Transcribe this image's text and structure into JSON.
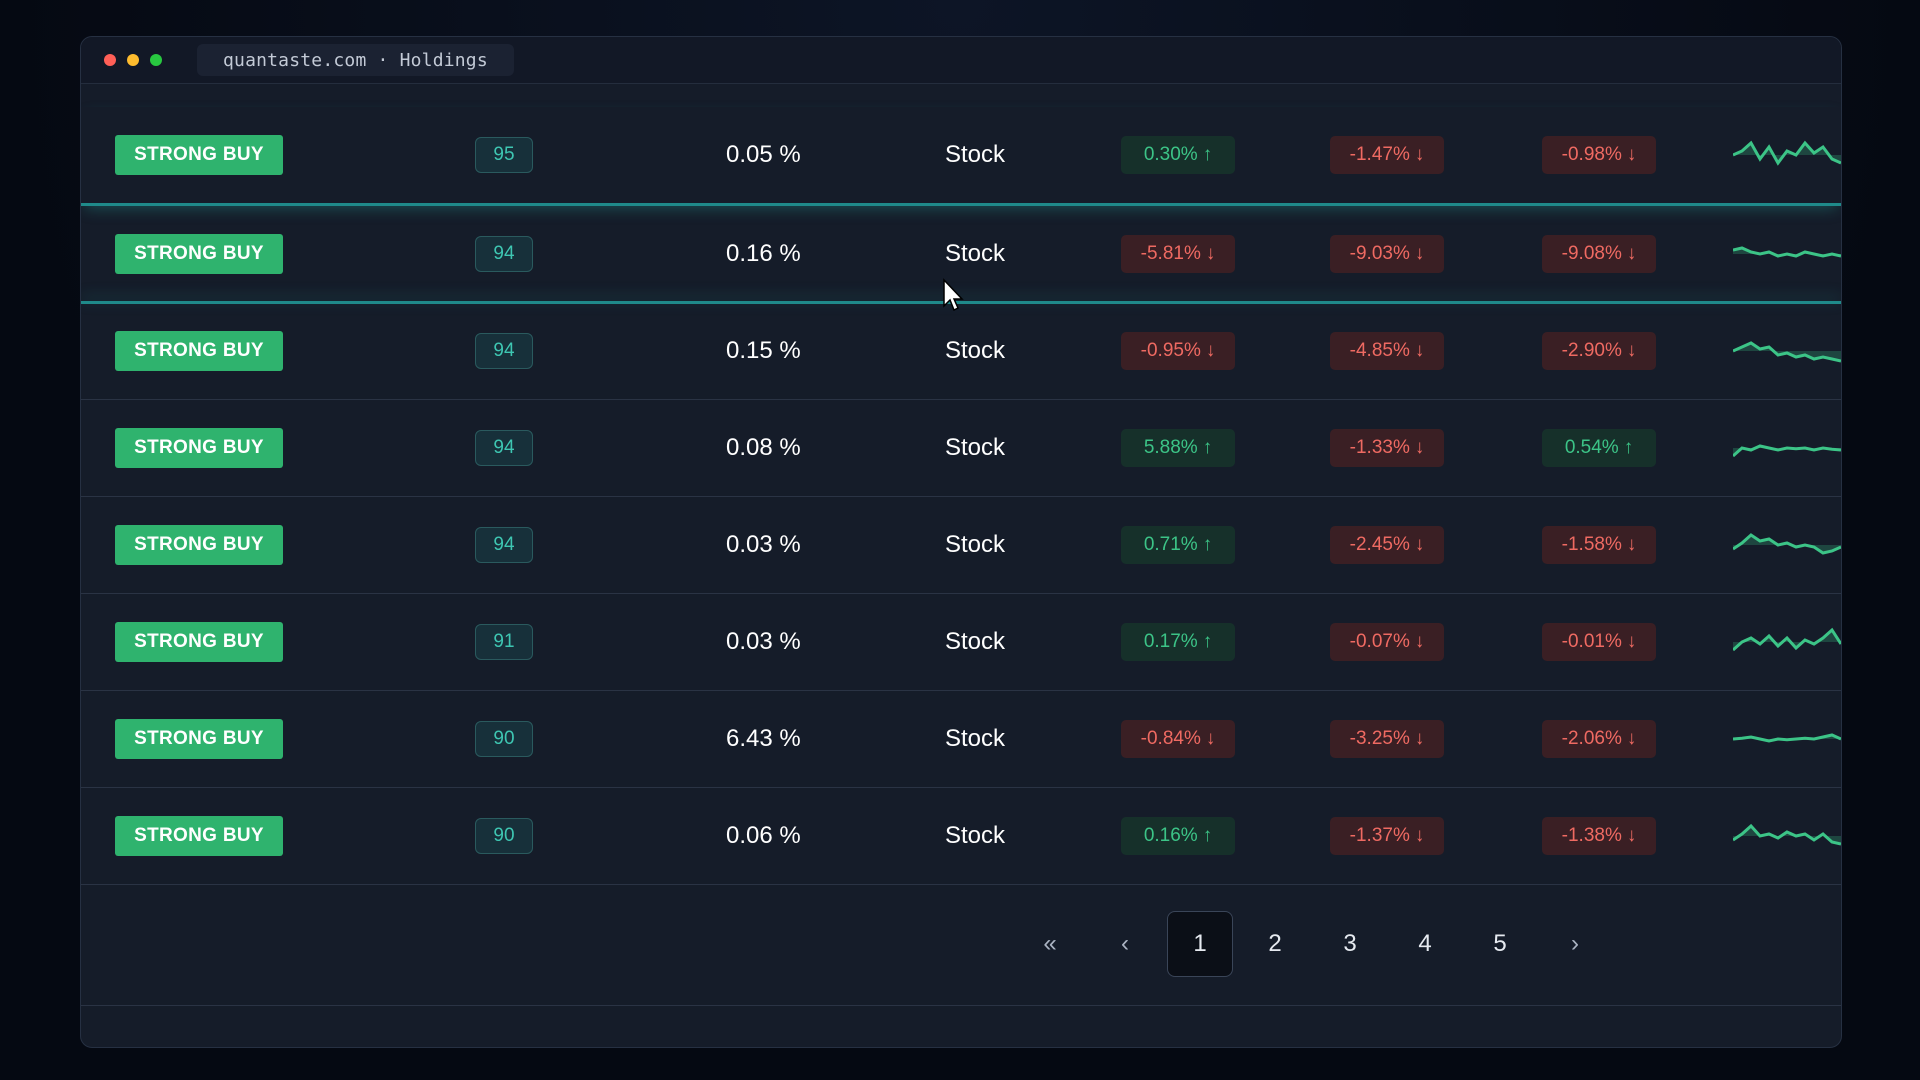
{
  "window": {
    "url_label": "quantaste.com · Holdings"
  },
  "rows": [
    {
      "rating": "STRONG BUY",
      "score": "95",
      "weight": "0.05 %",
      "type": "Stock",
      "c1": {
        "text": "0.30%",
        "dir": "up"
      },
      "c2": {
        "text": "-1.47%",
        "dir": "down"
      },
      "c3": {
        "text": "-0.98%",
        "dir": "down"
      },
      "spark": [
        0.5,
        0.6,
        0.8,
        0.4,
        0.7,
        0.3,
        0.6,
        0.5,
        0.8,
        0.55,
        0.7,
        0.4,
        0.3
      ],
      "spark_color": "#3cc487"
    },
    {
      "rating": "STRONG BUY",
      "score": "94",
      "weight": "0.16 %",
      "type": "Stock",
      "c1": {
        "text": "-5.81%",
        "dir": "down"
      },
      "c2": {
        "text": "-9.03%",
        "dir": "down"
      },
      "c3": {
        "text": "-9.08%",
        "dir": "down"
      },
      "spark": [
        0.6,
        0.65,
        0.55,
        0.5,
        0.55,
        0.45,
        0.5,
        0.45,
        0.55,
        0.5,
        0.45,
        0.5,
        0.45
      ],
      "spark_color": "#3cc487"
    },
    {
      "rating": "STRONG BUY",
      "score": "94",
      "weight": "0.15 %",
      "type": "Stock",
      "c1": {
        "text": "-0.95%",
        "dir": "down"
      },
      "c2": {
        "text": "-4.85%",
        "dir": "down"
      },
      "c3": {
        "text": "-2.90%",
        "dir": "down"
      },
      "spark": [
        0.5,
        0.6,
        0.7,
        0.55,
        0.6,
        0.4,
        0.45,
        0.35,
        0.4,
        0.3,
        0.35,
        0.3,
        0.25
      ],
      "spark_color": "#3cc487"
    },
    {
      "rating": "STRONG BUY",
      "score": "94",
      "weight": "0.08 %",
      "type": "Stock",
      "c1": {
        "text": "5.88%",
        "dir": "up"
      },
      "c2": {
        "text": "-1.33%",
        "dir": "down"
      },
      "c3": {
        "text": "0.54%",
        "dir": "up"
      },
      "spark": [
        0.3,
        0.5,
        0.45,
        0.55,
        0.5,
        0.45,
        0.5,
        0.48,
        0.5,
        0.45,
        0.5,
        0.47,
        0.45
      ],
      "spark_color": "#3cc487"
    },
    {
      "rating": "STRONG BUY",
      "score": "94",
      "weight": "0.03 %",
      "type": "Stock",
      "c1": {
        "text": "0.71%",
        "dir": "up"
      },
      "c2": {
        "text": "-2.45%",
        "dir": "down"
      },
      "c3": {
        "text": "-1.58%",
        "dir": "down"
      },
      "spark": [
        0.4,
        0.55,
        0.75,
        0.6,
        0.65,
        0.5,
        0.55,
        0.45,
        0.5,
        0.45,
        0.3,
        0.35,
        0.45
      ],
      "spark_color": "#3cc487"
    },
    {
      "rating": "STRONG BUY",
      "score": "91",
      "weight": "0.03 %",
      "type": "Stock",
      "c1": {
        "text": "0.17%",
        "dir": "up"
      },
      "c2": {
        "text": "-0.07%",
        "dir": "down"
      },
      "c3": {
        "text": "-0.01%",
        "dir": "down"
      },
      "spark": [
        0.3,
        0.5,
        0.6,
        0.45,
        0.65,
        0.4,
        0.6,
        0.35,
        0.55,
        0.45,
        0.6,
        0.8,
        0.45
      ],
      "spark_color": "#3cc487"
    },
    {
      "rating": "STRONG BUY",
      "score": "90",
      "weight": "6.43 %",
      "type": "Stock",
      "c1": {
        "text": "-0.84%",
        "dir": "down"
      },
      "c2": {
        "text": "-3.25%",
        "dir": "down"
      },
      "c3": {
        "text": "-2.06%",
        "dir": "down"
      },
      "spark": [
        0.5,
        0.52,
        0.55,
        0.5,
        0.45,
        0.5,
        0.48,
        0.5,
        0.52,
        0.5,
        0.55,
        0.6,
        0.5
      ],
      "spark_color": "#3cc487"
    },
    {
      "rating": "STRONG BUY",
      "score": "90",
      "weight": "0.06 %",
      "type": "Stock",
      "c1": {
        "text": "0.16%",
        "dir": "up"
      },
      "c2": {
        "text": "-1.37%",
        "dir": "down"
      },
      "c3": {
        "text": "-1.38%",
        "dir": "down"
      },
      "spark": [
        0.4,
        0.55,
        0.75,
        0.5,
        0.55,
        0.45,
        0.6,
        0.5,
        0.55,
        0.4,
        0.55,
        0.35,
        0.3
      ],
      "spark_color": "#3cc487"
    }
  ],
  "pagination": {
    "first_icon": "«",
    "prev_icon": "‹",
    "pages": [
      "1",
      "2",
      "3",
      "4",
      "5"
    ],
    "active_page": "1",
    "next_icon": "›"
  },
  "colors": {
    "up": "#3cc487",
    "down": "#ef6a62",
    "accent": "#2fb36e",
    "highlight": "#1f8a8a"
  }
}
